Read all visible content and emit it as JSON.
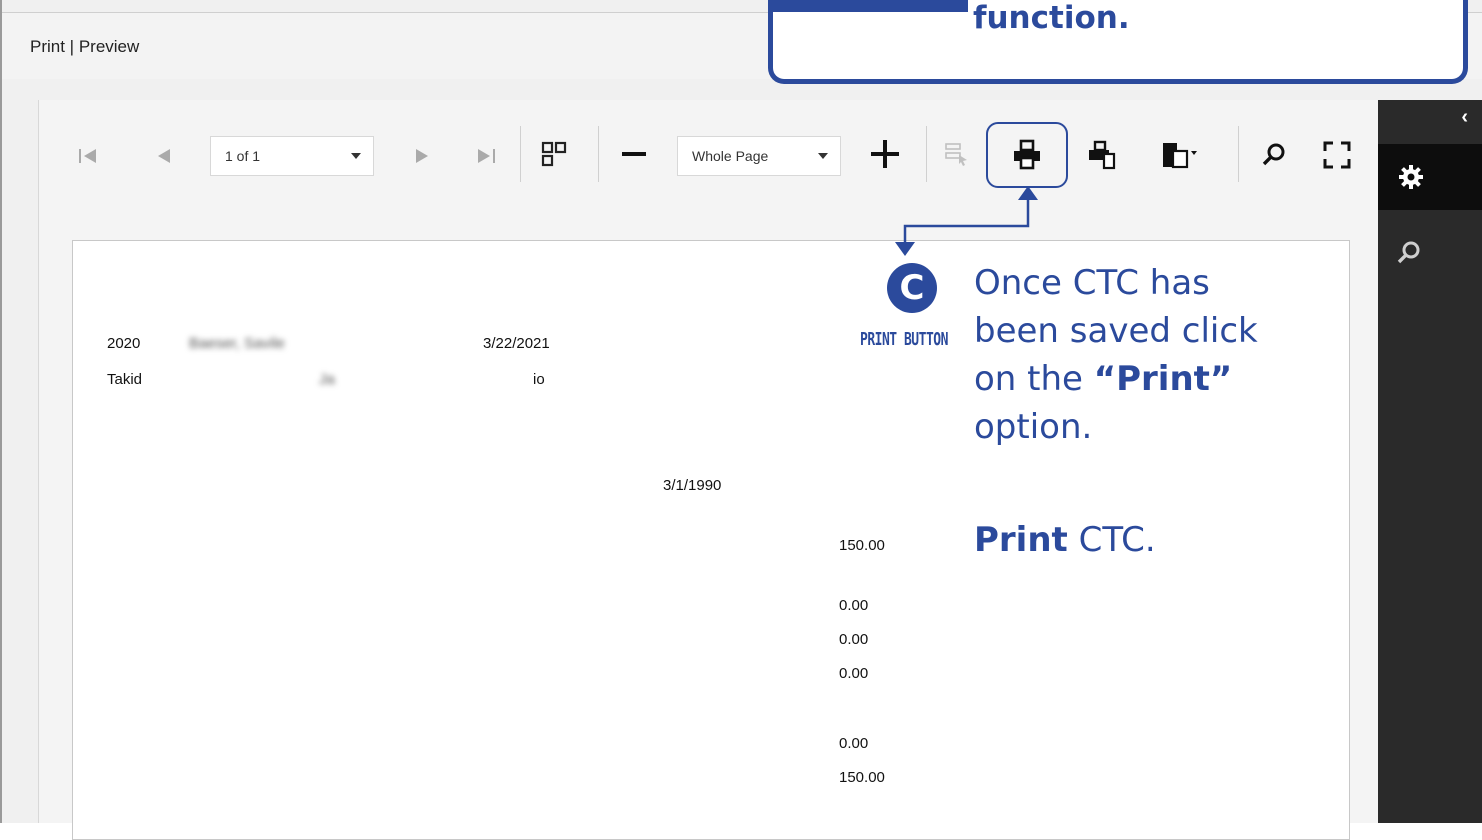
{
  "window": {
    "title": "Print | Preview"
  },
  "toolbar": {
    "page_selector": "1 of 1",
    "zoom_selector": "Whole Page"
  },
  "report": {
    "row1": {
      "year": "2020",
      "name": "Baeser, Savile",
      "date": "3/22/2021"
    },
    "row2": {
      "name": "Takid",
      "field2": "Ja",
      "field3": "io"
    },
    "dob": "3/1/1990",
    "amounts": [
      "150.00",
      "0.00",
      "0.00",
      "0.00",
      "0.00",
      "150.00"
    ]
  },
  "callout": {
    "top_text": "function.",
    "badge": "C",
    "badge_label": "PRINT BUTTON",
    "line1": "Once CTC has",
    "line2": "been saved click",
    "line3_pre": "on the ",
    "line3_bold": "“Print”",
    "line4": "option.",
    "print_bold": "Print",
    "print_rest": " CTC."
  },
  "colors": {
    "accent": "#2b4a9c",
    "panel": "#2a2a2a"
  }
}
